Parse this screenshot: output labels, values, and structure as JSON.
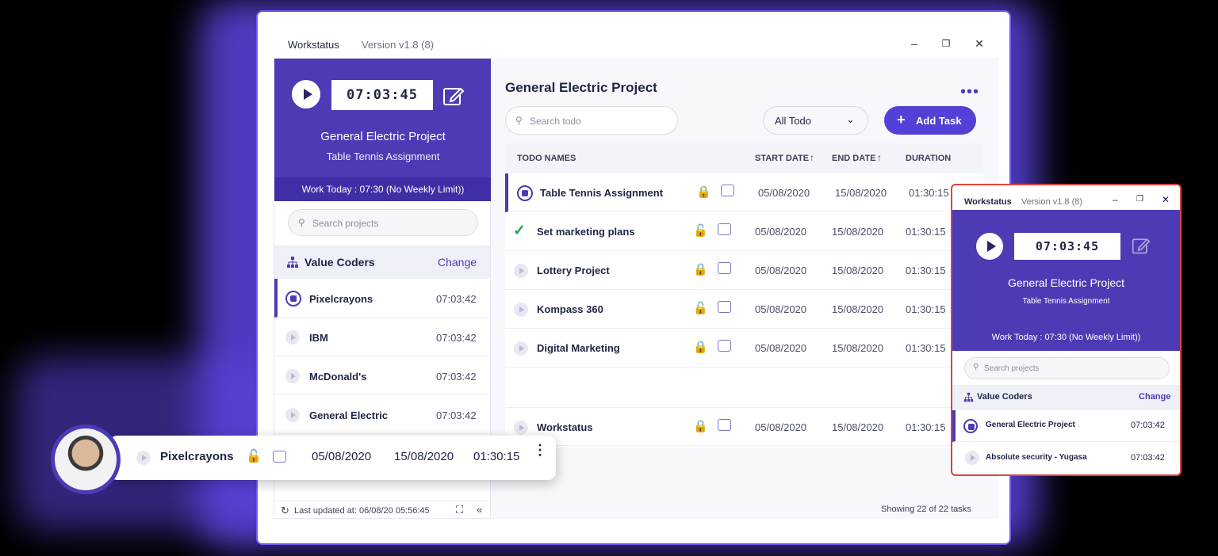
{
  "main_window": {
    "app_name": "Workstatus",
    "version": "Version v1.8 (8)",
    "timer": "07:03:45",
    "project_title": "General Electric Project",
    "project_subtitle": "Table Tennis Assignment",
    "work_today": "Work Today : 07:30 (No Weekly Limit))",
    "search_projects_placeholder": "Search projects",
    "org_name": "Value Coders",
    "change_label": "Change",
    "projects": [
      {
        "name": "Pixelcrayons",
        "time": "07:03:42",
        "active": true
      },
      {
        "name": "IBM",
        "time": "07:03:42",
        "active": false
      },
      {
        "name": "McDonald's",
        "time": "07:03:42",
        "active": false
      },
      {
        "name": "General Electric",
        "time": "07:03:42",
        "active": false
      }
    ],
    "last_updated": "Last updated at: 06/08/20  05:56:45",
    "right_title": "General Electric Project",
    "search_todo_placeholder": "Search todo",
    "filter_value": "All Todo",
    "add_task_label": "Add Task",
    "columns": [
      "TODO NAMES",
      "START DATE",
      "END DATE",
      "DURATION"
    ],
    "todos": [
      {
        "name": "Table Tennis Assignment",
        "start": "05/08/2020",
        "end": "15/08/2020",
        "duration": "01:30:15",
        "status": "active"
      },
      {
        "name": "Set marketing plans",
        "start": "05/08/2020",
        "end": "15/08/2020",
        "duration": "01:30:15",
        "status": "done"
      },
      {
        "name": "Lottery Project",
        "start": "05/08/2020",
        "end": "15/08/2020",
        "duration": "01:30:15",
        "status": "idle"
      },
      {
        "name": "Kompass 360",
        "start": "05/08/2020",
        "end": "15/08/2020",
        "duration": "01:30:15",
        "status": "idle"
      },
      {
        "name": "Digital Marketing",
        "start": "05/08/2020",
        "end": "15/08/2020",
        "duration": "01:30:15",
        "status": "idle"
      },
      {
        "name": "Workstatus",
        "start": "05/08/2020",
        "end": "15/08/2020",
        "duration": "01:30:15",
        "status": "idle"
      }
    ],
    "showing": "Showing 22 of 22 tasks"
  },
  "floating_row": {
    "name": "Pixelcrayons",
    "start": "05/08/2020",
    "end": "15/08/2020",
    "duration": "01:30:15"
  },
  "mini_window": {
    "app_name": "Workstatus",
    "version": "Version v1.8 (8)",
    "timer": "07:03:45",
    "project_title": "General Electric Project",
    "project_subtitle": "Table Tennis Assignment",
    "work_today": "Work Today : 07:30 (No Weekly Limit))",
    "search_projects_placeholder": "Search projects",
    "org_name": "Value Coders",
    "change_label": "Change",
    "projects": [
      {
        "name": "General Electric Project",
        "time": "07:03:42"
      },
      {
        "name": "Absolute security - Yugasa",
        "time": "07:03:42"
      }
    ]
  },
  "colors": {
    "accent": "#4d3bb5",
    "button": "#5340d6",
    "highlight": "#e0413f"
  }
}
